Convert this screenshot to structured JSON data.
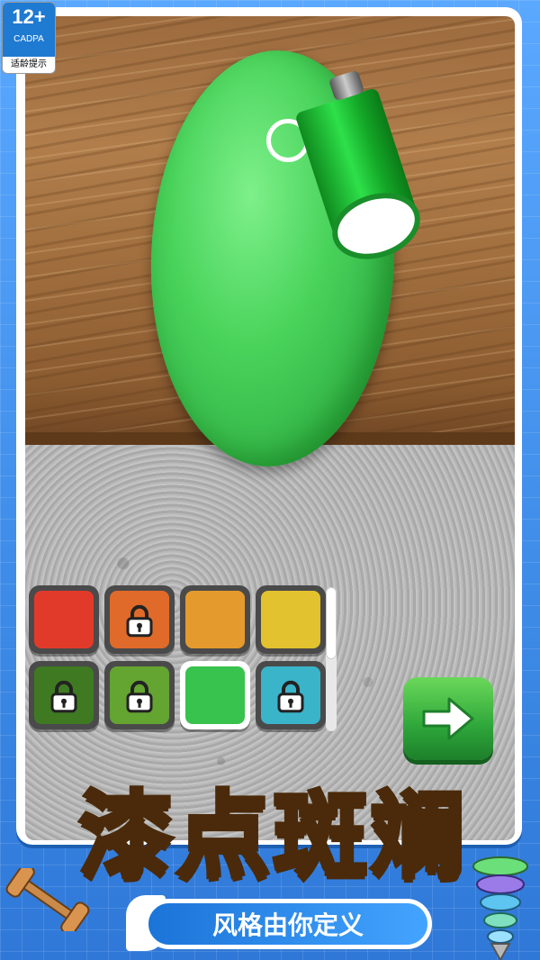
{
  "age_rating": {
    "age": "12+",
    "org": "CADPA",
    "note": "适龄提示"
  },
  "title": "漆点斑斓",
  "subtitle": "风格由你定义",
  "palette": [
    {
      "color": "#e23a2a",
      "locked": false,
      "selected": false
    },
    {
      "color": "#e06a2a",
      "locked": true,
      "selected": false
    },
    {
      "color": "#e59a2e",
      "locked": false,
      "selected": false
    },
    {
      "color": "#e2c22e",
      "locked": false,
      "selected": false
    },
    {
      "color": "#3f7a22",
      "locked": true,
      "selected": false
    },
    {
      "color": "#64a431",
      "locked": true,
      "selected": false
    },
    {
      "color": "#38c24e",
      "locked": false,
      "selected": true
    },
    {
      "color": "#3ab4c8",
      "locked": true,
      "selected": false
    }
  ],
  "icons": {
    "next": "arrow-right-icon",
    "lock": "padlock-icon",
    "spray": "spray-can-icon"
  },
  "accent": "#3e8ce8"
}
